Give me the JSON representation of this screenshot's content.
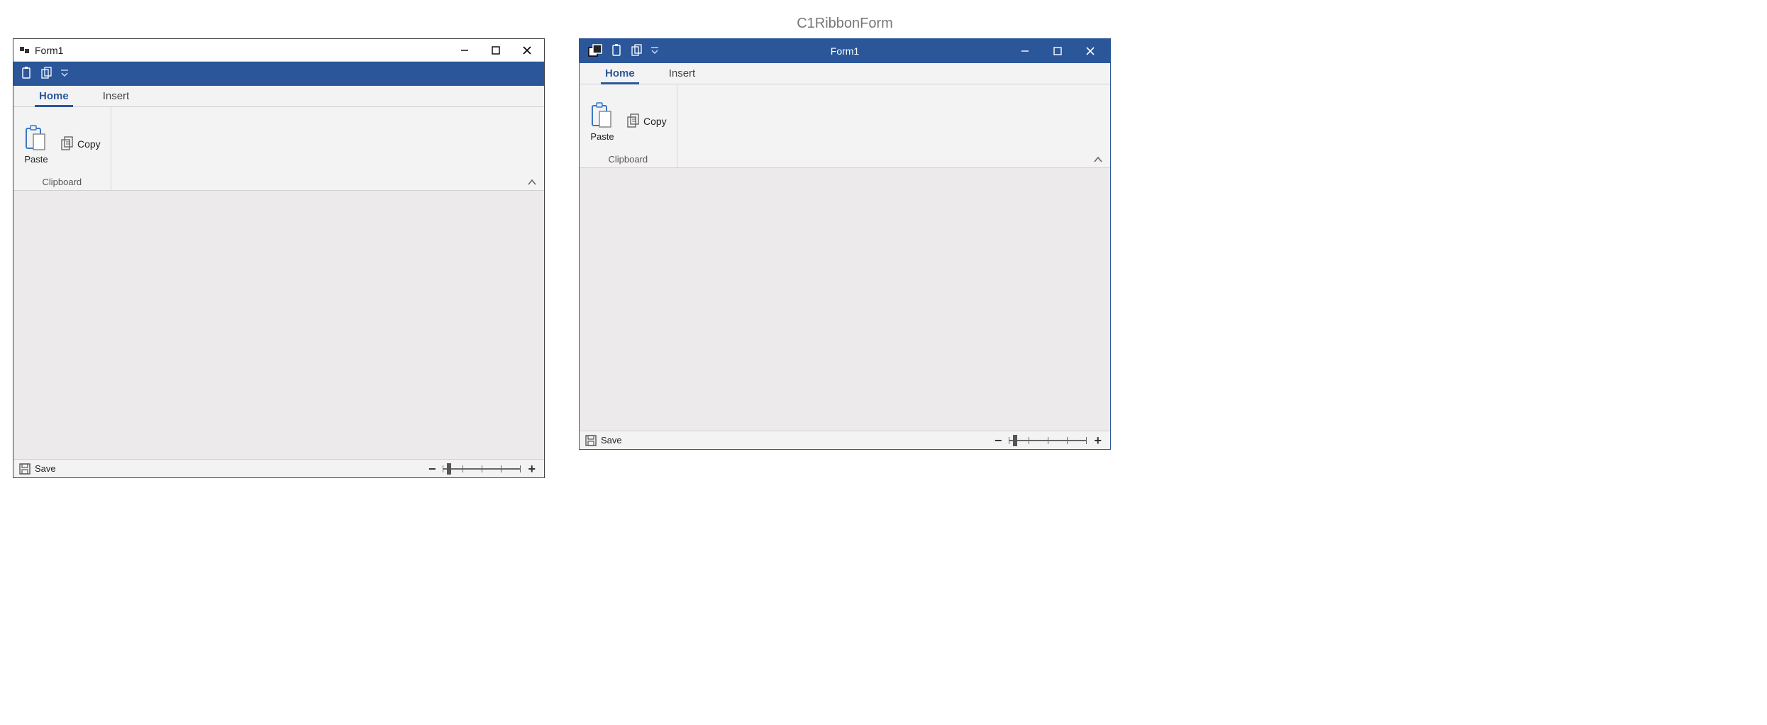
{
  "caption_right": "C1RibbonForm",
  "left_window": {
    "title": "Form1",
    "qat": {
      "items": [
        "paste-icon",
        "copy-icon"
      ],
      "dropdown": true
    },
    "tabs": [
      {
        "label": "Home",
        "active": true
      },
      {
        "label": "Insert",
        "active": false
      }
    ],
    "ribbon": {
      "group_name": "Clipboard",
      "paste_label": "Paste",
      "copy_label": "Copy"
    },
    "status": {
      "save_label": "Save"
    }
  },
  "right_window": {
    "title": "Form1",
    "qat": {
      "items": [
        "app-icon",
        "paste-icon",
        "copy-icon"
      ],
      "dropdown": true
    },
    "tabs": [
      {
        "label": "Home",
        "active": true
      },
      {
        "label": "Insert",
        "active": false
      }
    ],
    "ribbon": {
      "group_name": "Clipboard",
      "paste_label": "Paste",
      "copy_label": "Copy"
    },
    "status": {
      "save_label": "Save"
    }
  },
  "colors": {
    "ribbon_blue": "#2b579a"
  }
}
